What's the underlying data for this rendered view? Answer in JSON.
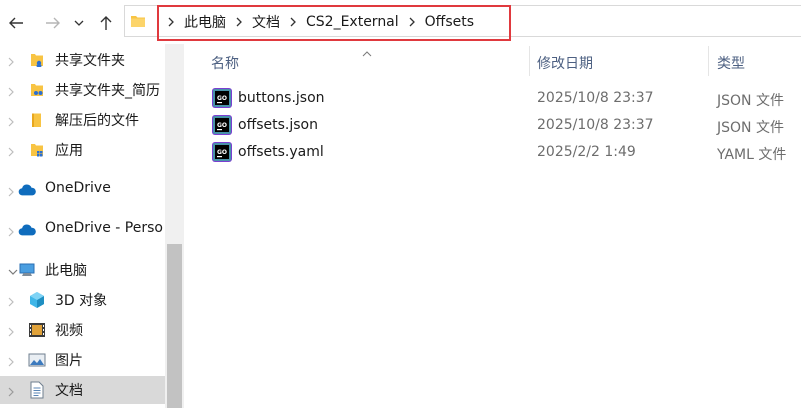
{
  "nav": {
    "back_icon": "back-arrow-icon",
    "forward_icon": "forward-arrow-icon",
    "recent_icon": "chevron-down-icon",
    "up_icon": "up-arrow-icon"
  },
  "address_bar": {
    "crumbs": [
      "此电脑",
      "文档",
      "CS2_External",
      "Offsets"
    ]
  },
  "sidebar": {
    "items": [
      {
        "label": "共享文件夹",
        "icon": "shared-folder-icon"
      },
      {
        "label": "共享文件夹_简历",
        "icon": "shared-folder-icon"
      },
      {
        "label": "解压后的文件",
        "icon": "folder-icon"
      },
      {
        "label": "应用",
        "icon": "shared-folder-icon"
      },
      {
        "label": "OneDrive",
        "icon": "cloud-icon"
      },
      {
        "label": "OneDrive - Perso",
        "icon": "cloud-icon"
      },
      {
        "label": "此电脑",
        "icon": "computer-icon"
      },
      {
        "label": "3D 对象",
        "icon": "3d-objects-icon"
      },
      {
        "label": "视频",
        "icon": "video-icon"
      },
      {
        "label": "图片",
        "icon": "pictures-icon"
      },
      {
        "label": "文档",
        "icon": "documents-icon"
      }
    ]
  },
  "columns": {
    "name": "名称",
    "date": "修改日期",
    "type": "类型"
  },
  "files": [
    {
      "name": "buttons.json",
      "date": "2025/10/8 23:37",
      "type": "JSON 文件"
    },
    {
      "name": "offsets.json",
      "date": "2025/10/8 23:37",
      "type": "JSON 文件"
    },
    {
      "name": "offsets.yaml",
      "date": "2025/2/2 1:49",
      "type": "YAML 文件"
    }
  ],
  "colors": {
    "highlight_box": "#e0393e",
    "selected_bg": "#cce8ff",
    "column_header_text": "#4d6082",
    "secondary_text": "#6d6d6d",
    "folder_yellow": "#f8c443",
    "onedrive_blue": "#0f6cbd"
  }
}
